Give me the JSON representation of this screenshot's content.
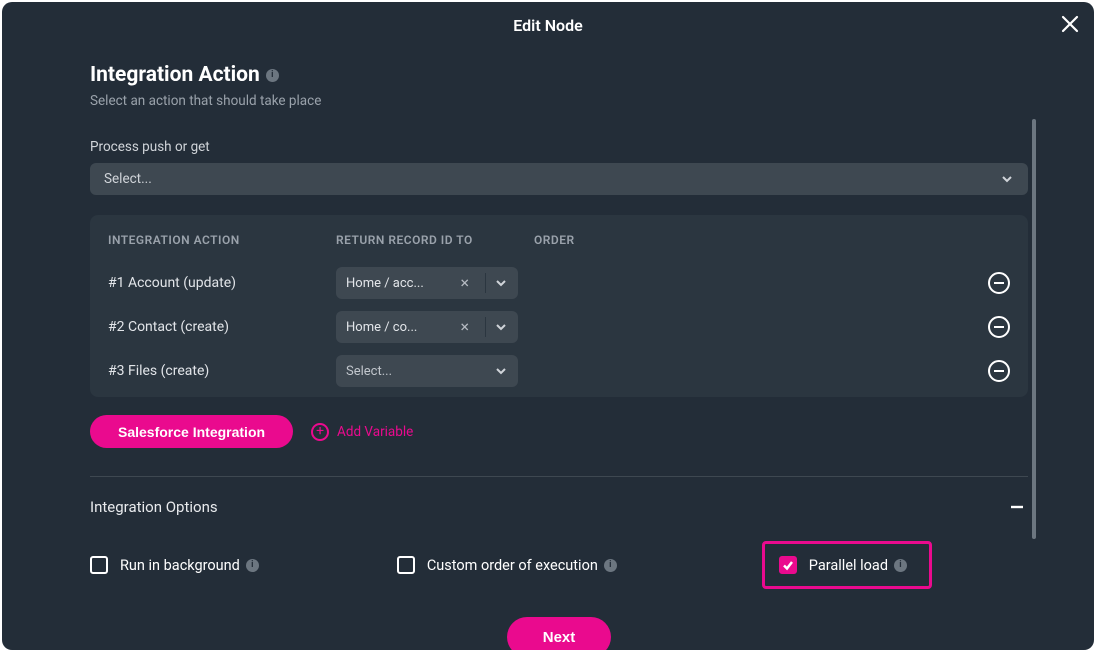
{
  "dialog": {
    "title": "Edit Node"
  },
  "section": {
    "title": "Integration Action",
    "subtitle": "Select an action that should take place"
  },
  "process": {
    "label": "Process push or get",
    "placeholder": "Select..."
  },
  "table": {
    "headers": {
      "action": "INTEGRATION ACTION",
      "return": "RETURN RECORD ID TO",
      "order": "ORDER"
    },
    "rows": [
      {
        "label": "#1 Account (update)",
        "return": "Home / acc...",
        "has_value": true
      },
      {
        "label": "#2 Contact (create)",
        "return": "Home / co...",
        "has_value": true
      },
      {
        "label": "#3 Files (create)",
        "return": "Select...",
        "has_value": false
      }
    ]
  },
  "buttons": {
    "salesforce": "Salesforce Integration",
    "add_variable": "Add Variable",
    "next": "Next"
  },
  "options": {
    "title": "Integration Options",
    "run_bg": "Run in background",
    "custom_order": "Custom order of execution",
    "parallel": "Parallel load",
    "parallel_checked": true
  }
}
